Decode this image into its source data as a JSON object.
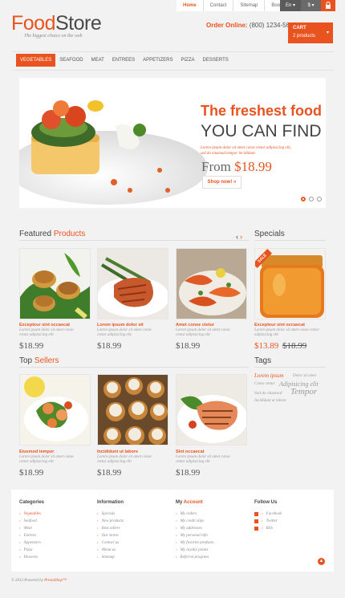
{
  "header": {
    "logo_part1": "Food",
    "logo_part2": "Store",
    "tagline": "The biggest choice on the web",
    "top_links": [
      "Home",
      "Contact",
      "Sitemap",
      "Bookmark"
    ],
    "language": "En",
    "currency": "$",
    "order_label": "Order Online:",
    "order_number": "(800) 1234-5678",
    "cart_title": "CART",
    "cart_count": "2 products"
  },
  "menu": [
    "Vegetables",
    "Seafood",
    "Meat",
    "Entrees",
    "Appetizers",
    "Pizza",
    "Desserts"
  ],
  "slider": {
    "title1": "The freshest food",
    "title2": "YOU CAN FIND",
    "desc": "Lorem ipsum dolor sit amet conse ctetur adipisicing elit, sed do eiusmod tempor incididunt.",
    "from_label": "From",
    "price": "$18.99",
    "button": "Shop now!"
  },
  "featured": {
    "title_a": "Featured",
    "title_b": "Products",
    "items": [
      {
        "name": "Excepteur sint occaecat",
        "desc": "Lorem ipsum dolor sit amet conse ctetur adipisicing elit",
        "price": "$18.99"
      },
      {
        "name": "Lorem ipsum dolor sit",
        "desc": "Lorem ipsum dolor sit amet conse ctetur adipisicing elit",
        "price": "$18.99"
      },
      {
        "name": "Amet conse ctetur",
        "desc": "Lorem ipsum dolor sit amet conse ctetur adipisicing elit",
        "price": "$18.99"
      }
    ]
  },
  "specials": {
    "title": "Specials",
    "badge": "SALE",
    "item": {
      "name": "Excepteur sint occaecat",
      "desc": "Lorem ipsum dolor sit amet conse ctetur adipisicing elit",
      "price": "$13.89",
      "old_price": "$18.99"
    }
  },
  "top_sellers": {
    "title_a": "Top",
    "title_b": "Sellers",
    "items": [
      {
        "name": "Eiusmod tempor",
        "desc": "Lorem ipsum dolor sit amet conse ctetur adipisicing elit",
        "price": "$18.99"
      },
      {
        "name": "Incididunt ut labore",
        "desc": "Lorem ipsum dolor sit amet conse ctetur adipisicing elit",
        "price": "$18.99"
      },
      {
        "name": "Sint occaecat",
        "desc": "Lorem ipsum dolor sit amet conse ctetur adipisicing elit",
        "price": "$18.99"
      }
    ]
  },
  "tags": {
    "title": "Tags",
    "items": [
      "Lorem ipsum",
      "Dolor sit amet",
      "Conse ctetur",
      "Adipisicing elit",
      "Sed do eiusmod",
      "Tempor",
      "Incididunt ut labore"
    ]
  },
  "footer": {
    "categories": {
      "title": "Categories",
      "links": [
        "Vegetables",
        "Seafood",
        "Meat",
        "Entrees",
        "Appetizers",
        "Pizza",
        "Desserts"
      ]
    },
    "information": {
      "title": "Information",
      "links": [
        "Specials",
        "New products",
        "Best sellers",
        "Our stores",
        "Contact us",
        "About us",
        "Sitemap"
      ]
    },
    "account": {
      "title_a": "My",
      "title_b": "Account",
      "links": [
        "My orders",
        "My credit slips",
        "My addresses",
        "My personal info",
        "My favorite products",
        "My loyalty points",
        "Referral program"
      ]
    },
    "follow": {
      "title": "Follow Us",
      "links": [
        "Facebook",
        "Twitter",
        "RSS"
      ]
    },
    "copyright_a": "© 2013 Powered by",
    "copyright_b": "PrestaShop™"
  },
  "colors": {
    "accent": "#e8531f",
    "dark": "#444444"
  }
}
